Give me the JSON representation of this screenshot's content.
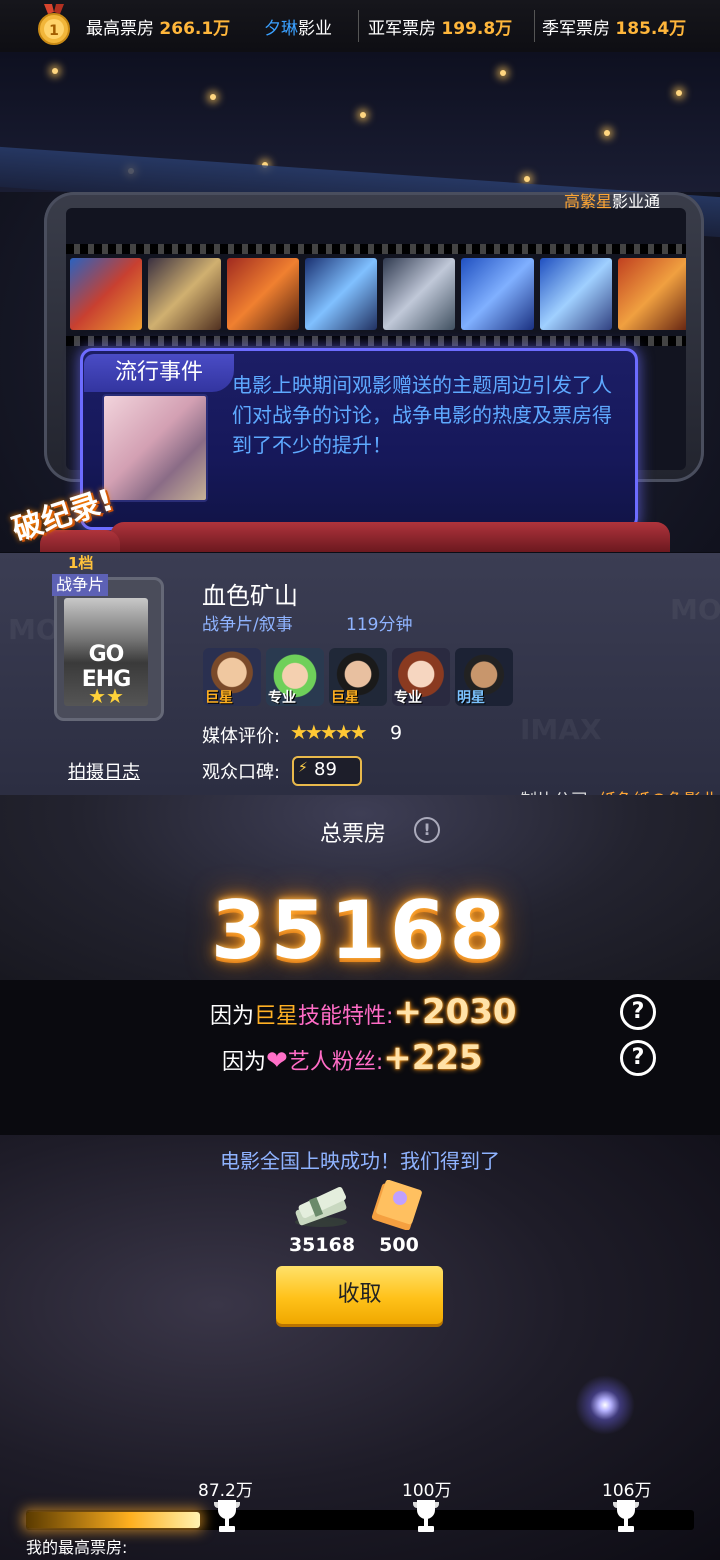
{
  "topbar": {
    "highest_label": "最高票房",
    "highest_value": "266.1万",
    "studio": "夕琳",
    "studio_suffix": "影业",
    "runner_label": "亚军票房",
    "runner_value": "199.8万",
    "third_label": "季军票房",
    "third_value": "185.4万"
  },
  "brand": {
    "highlight": "高繁星",
    "rest": "影业通"
  },
  "event": {
    "tag": "流行事件",
    "text": "电影上映期间观影赠送的主题周边引发了人们对战争的讨论，战争电影的热度及票房得到了不少的提升！"
  },
  "record_label": "破纪录!",
  "movie": {
    "tier": "1档",
    "genre_badge": "战争片",
    "poster_title": "GO EHG",
    "poster_stars": "★★",
    "shoot_log": "拍摄日志",
    "title": "血色矿山",
    "genre": "战争片/叙事",
    "duration": "119分钟",
    "cast": [
      {
        "tag": "巨星",
        "tag_color": "orange"
      },
      {
        "tag": "专业",
        "tag_color": "white"
      },
      {
        "tag": "巨星",
        "tag_color": "orange"
      },
      {
        "tag": "专业",
        "tag_color": "white"
      },
      {
        "tag": "明星",
        "tag_color": "blue"
      }
    ],
    "media_label": "媒体评价:",
    "media_stars": "★★★★★",
    "media_score": "9",
    "audience_label": "观众口碑:",
    "audience_score": "89",
    "producer_label": "制片公司:",
    "producer": "纸鱼紙の魚影业"
  },
  "box_office": {
    "label": "总票房",
    "info_icon": "!",
    "total": "35168",
    "bonus": [
      {
        "prefix": "因为",
        "highlight": "巨星",
        "suffix": "技能特性:",
        "value": "+2030"
      },
      {
        "prefix": "因为",
        "highlight": "艺人粉丝:",
        "suffix": "",
        "value": "+225"
      }
    ],
    "help_icon": "?"
  },
  "rewards": {
    "title": "电影全国上映成功！我们得到了",
    "money": "35168",
    "books": "500",
    "collect": "收取"
  },
  "progress": {
    "milestones": [
      "87.2万",
      "100万",
      "106万"
    ],
    "my_best_label": "我的最高票房:",
    "fill_fraction": 0.26
  },
  "colors": {
    "accent_orange": "#ffb63b",
    "link_blue": "#3aa0ff",
    "button_yellow": "#ffc21a"
  }
}
